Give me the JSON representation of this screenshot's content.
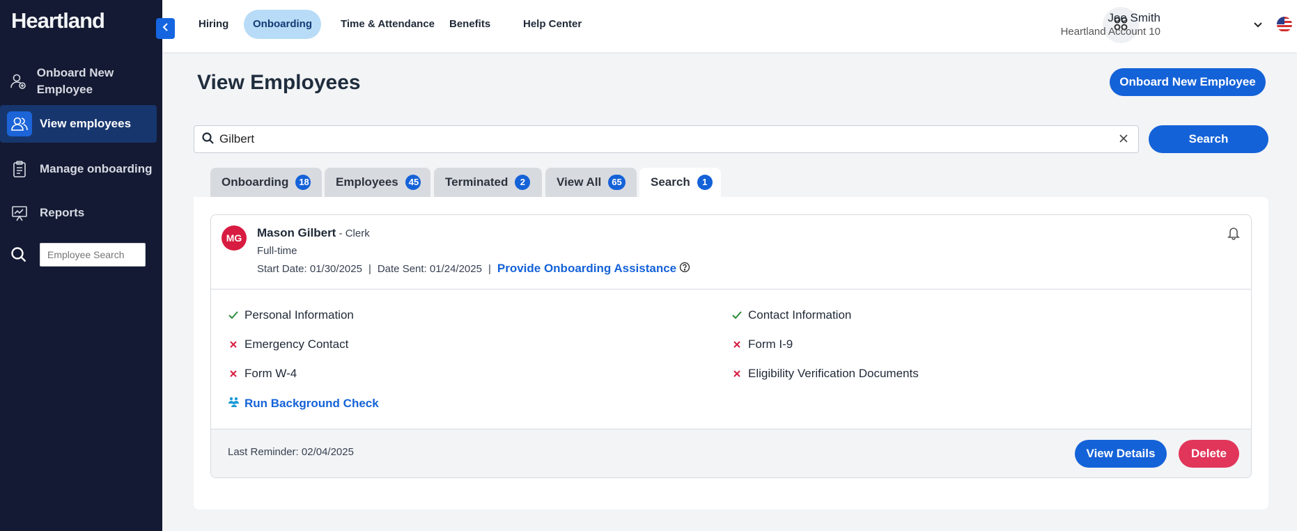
{
  "brand": {
    "logo": "Heartland"
  },
  "sidebar": {
    "items": [
      {
        "label": "Onboard New Employee",
        "icon": "user-add-icon"
      },
      {
        "label": "View employees",
        "icon": "users-icon",
        "active": true
      },
      {
        "label": "Manage onboarding",
        "icon": "clipboard-icon"
      },
      {
        "label": "Reports",
        "icon": "chart-board-icon"
      }
    ],
    "search_placeholder": "Employee Search"
  },
  "topnav": {
    "tabs": [
      {
        "label": "Hiring"
      },
      {
        "label": "Onboarding",
        "active": true
      },
      {
        "label": "Time & Attendance"
      },
      {
        "label": "Benefits"
      },
      {
        "label": "Help Center"
      }
    ],
    "user": {
      "name": "Joe Smith",
      "account": "Heartland Account 10"
    }
  },
  "main": {
    "title": "View Employees",
    "onboard_button": "Onboard New Employee",
    "search": {
      "value": "Gilbert",
      "button": "Search"
    },
    "filter_tabs": [
      {
        "label": "Onboarding",
        "count": "18"
      },
      {
        "label": "Employees",
        "count": "45"
      },
      {
        "label": "Terminated",
        "count": "2"
      },
      {
        "label": "View All",
        "count": "65"
      },
      {
        "label": "Search",
        "count": "1",
        "active": true
      }
    ]
  },
  "card": {
    "initials": "MG",
    "name": "Mason Gilbert",
    "title": " - Clerk",
    "employment_type": "Full-time",
    "start_date": "Start Date: 01/30/2025",
    "date_sent": "Date Sent: 01/24/2025",
    "assist_link": "Provide Onboarding Assistance",
    "checklist": [
      {
        "label": "Personal Information",
        "done": true
      },
      {
        "label": "Contact Information",
        "done": true
      },
      {
        "label": "Emergency Contact",
        "done": false
      },
      {
        "label": "Form I-9",
        "done": false
      },
      {
        "label": "Form W-4",
        "done": false
      },
      {
        "label": "Eligibility Verification Documents",
        "done": false
      }
    ],
    "background_check": "Run Background Check",
    "last_reminder": "Last Reminder: 02/04/2025",
    "view_details": "View Details",
    "delete": "Delete"
  },
  "colors": {
    "sidebar_bg": "#141a33",
    "primary": "#1462d8",
    "danger": "#e1355a",
    "success": "#2e8b3a",
    "fail": "#d81b40"
  }
}
